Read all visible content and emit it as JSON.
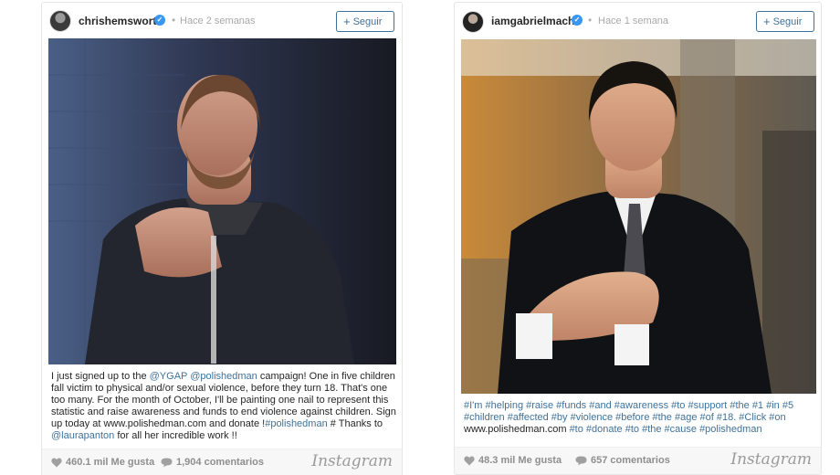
{
  "posts": [
    {
      "username": "chrishemsworth",
      "time": "Hace 2 semanas",
      "follow_label": "Seguir",
      "caption": [
        {
          "text": "I just signed up to the ",
          "tag": false
        },
        {
          "text": "@YGAP",
          "tag": true
        },
        {
          "text": " ",
          "tag": false
        },
        {
          "text": "@polishedman",
          "tag": true
        },
        {
          "text": " campaign! One in five children fall victim to physical and/or sexual violence, before they turn 18. That's one too many. For the month of October, I'll be painting one nail to represent this statistic and raise awareness and funds to end violence against children. Sign up today at www.polishedman.com and donate !",
          "tag": false
        },
        {
          "text": "#polishedman",
          "tag": true
        },
        {
          "text": " # Thanks to ",
          "tag": false
        },
        {
          "text": "@laurapanton",
          "tag": true
        },
        {
          "text": " for all her incredible work !!",
          "tag": false
        }
      ],
      "likes": "460.1 mil Me gusta",
      "comments": "1,904 comentarios",
      "brand": "Instagram"
    },
    {
      "username": "iamgabrielmacht",
      "time": "Hace 1 semana",
      "follow_label": "Seguir",
      "caption": [
        {
          "text": "#I'm #helping #raise #funds #and #awareness #to #support #the #1 #in #5 #children #affected #by #violence #before #the #age #of #18. #Click #on",
          "tag": true
        },
        {
          "text": " www.polishedman.com ",
          "tag": false
        },
        {
          "text": "#to #donate #to #the #cause #polishedman",
          "tag": true
        }
      ],
      "likes": "48.3 mil Me gusta",
      "comments": "657 comentarios",
      "brand": "Instagram"
    }
  ],
  "colors": {
    "link": "#3f729b",
    "verified": "#3897f0",
    "meta": "#8e8e8e"
  },
  "icons": {
    "verified": "verified-badge-icon",
    "follow": "plus-icon",
    "like": "heart-icon",
    "comment": "speech-bubble-icon"
  }
}
